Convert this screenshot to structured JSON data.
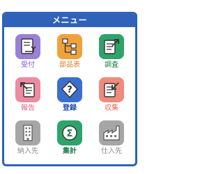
{
  "menu": {
    "title": "メニュー",
    "items": [
      {
        "label": "受付",
        "icon": "receipt-document-icon",
        "color": "#9b80d6",
        "label_color": "#7a5fc4"
      },
      {
        "label": "部品表",
        "icon": "hierarchy-tree-icon",
        "color": "#f0a23a",
        "label_color": "#e07a2a"
      },
      {
        "label": "調査",
        "icon": "document-arrow-icon",
        "color": "#2ea36a",
        "label_color": "#1e7a4a"
      },
      {
        "label": "報告",
        "icon": "report-document-icon",
        "color": "#ee8aa1",
        "label_color": "#d9607c"
      },
      {
        "label": "登録",
        "icon": "question-diamond-icon",
        "color": "#3a6fd0",
        "label_color": "#244fa8"
      },
      {
        "label": "収集",
        "icon": "collect-document-icon",
        "color": "#f08b7c",
        "label_color": "#e06a55"
      },
      {
        "label": "納入先",
        "icon": "building-icon",
        "color": "#a6a6a6",
        "label_color": "#8d8d8d"
      },
      {
        "label": "集計",
        "icon": "sigma-icon",
        "color": "#2ea36a",
        "label_color": "#1e7a4a"
      },
      {
        "label": "仕入先",
        "icon": "factory-icon",
        "color": "#a6a6a6",
        "label_color": "#8d8d8d"
      }
    ]
  }
}
